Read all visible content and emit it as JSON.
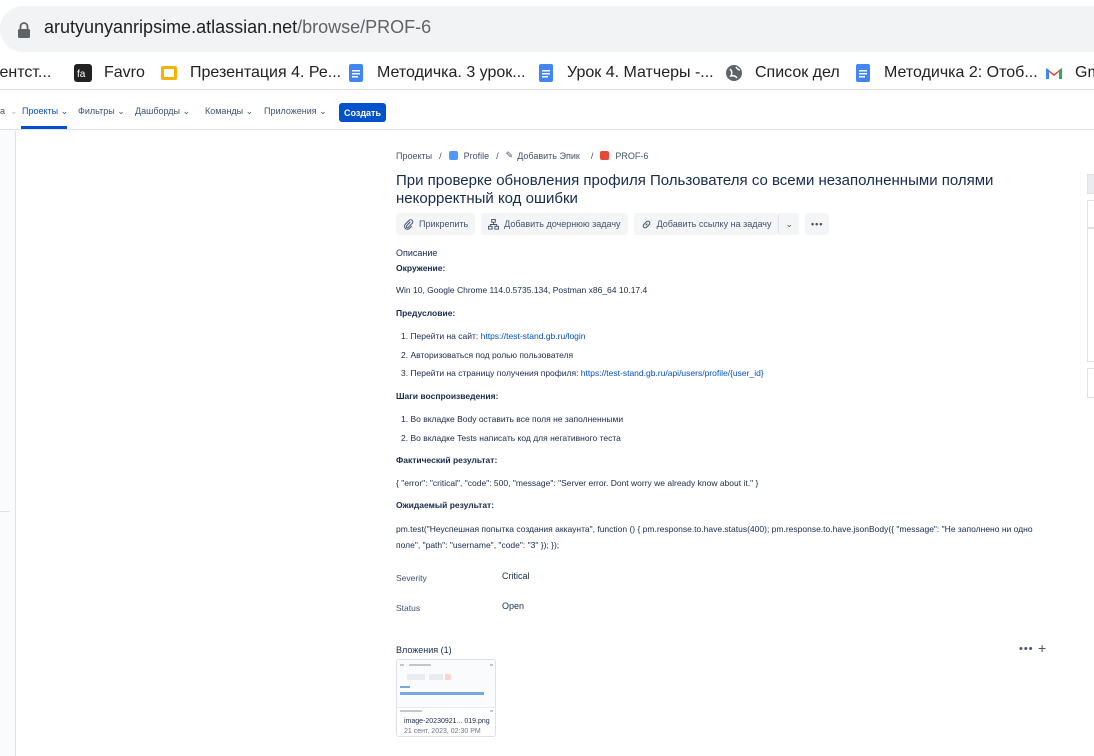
{
  "browser": {
    "url_host": "arutyunyanripsime.atlassian.net",
    "url_path": "/browse/PROF-6",
    "bookmarks": [
      {
        "label": "гентст...",
        "icon": "none"
      },
      {
        "label": "Favro",
        "icon": "favro-icon"
      },
      {
        "label": "Презентация 4. Ре...",
        "icon": "slides-icon"
      },
      {
        "label": "Методичка. 3 урок...",
        "icon": "docs-icon"
      },
      {
        "label": "Урок 4. Матчеры -...",
        "icon": "docs-icon"
      },
      {
        "label": "Список дел",
        "icon": "globe-icon"
      },
      {
        "label": "Методичка 2: Отоб...",
        "icon": "docs-icon"
      },
      {
        "label": "Gm",
        "icon": "gmail-icon"
      }
    ]
  },
  "nav": {
    "cut_item": "а",
    "items": [
      "Проекты",
      "Фильтры",
      "Дашборды",
      "Команды",
      "Приложения"
    ],
    "create": "Создать"
  },
  "breadcrumbs": {
    "projects": "Проекты",
    "project": "Profile",
    "add_epic": "Добавить Эпик",
    "issue_key": "PROF-6"
  },
  "issue": {
    "title": "При проверке обновления профиля Пользователя со всеми незаполненными полями некорректный код ошибки",
    "toolbar": {
      "attach": "Прикрепить",
      "child": "Добавить дочернюю задачу",
      "link": "Добавить ссылку на задачу"
    },
    "description_label": "Описание",
    "env_heading": "Окружение:",
    "env_text": "Win 10, Google Chrome 114.0.5735.134, Postman x86_64 10.17.4",
    "pre_heading": "Предусловие:",
    "pre_items": [
      {
        "text": "1. Перейти на сайт: ",
        "link": "https://test-stand.gb.ru/login"
      },
      {
        "text": "2. Авторизоваться под ролью пользователя",
        "link": ""
      },
      {
        "text": "3. Перейти на страницу получения профиля: ",
        "link": "https://test-stand.gb.ru/api/users/profile/{user_id}"
      }
    ],
    "steps_heading": "Шаги воспроизведения:",
    "steps": [
      "1. Во вкладке Body оставить все поля не заполненными",
      "2. Во вкладке Tests написать код для негативного теста"
    ],
    "actual_heading": "Фактический результат:",
    "actual_text": "{ \"error\": \"critical\", \"code\": 500, \"message\": \"Server error. Dont worry we already know about it.\" }",
    "expected_heading": "Ожидаемый результат:",
    "expected_text": "pm.test(\"Неуспешная попытка создания аккаунта\", function () { pm.response.to.have.status(400); pm.response.to.have.jsonBody({ \"message\": \"Не заполнено ни одно поле\", \"path\": \"username\", \"code\": \"3\" }); });",
    "fields": [
      {
        "label": "Severity",
        "value": "Critical"
      },
      {
        "label": "Status",
        "value": "Open"
      }
    ],
    "attachments_title": "Вложения (1)",
    "attachment": {
      "name": "image-20230921... 019.png",
      "date": "21 сент. 2023, 02:30 PM"
    }
  },
  "colors": {
    "accent": "#0052cc",
    "text": "#172b4d",
    "subtle": "#42526e",
    "bug_red": "#e5493a",
    "project_blue": "#4c9aff"
  }
}
